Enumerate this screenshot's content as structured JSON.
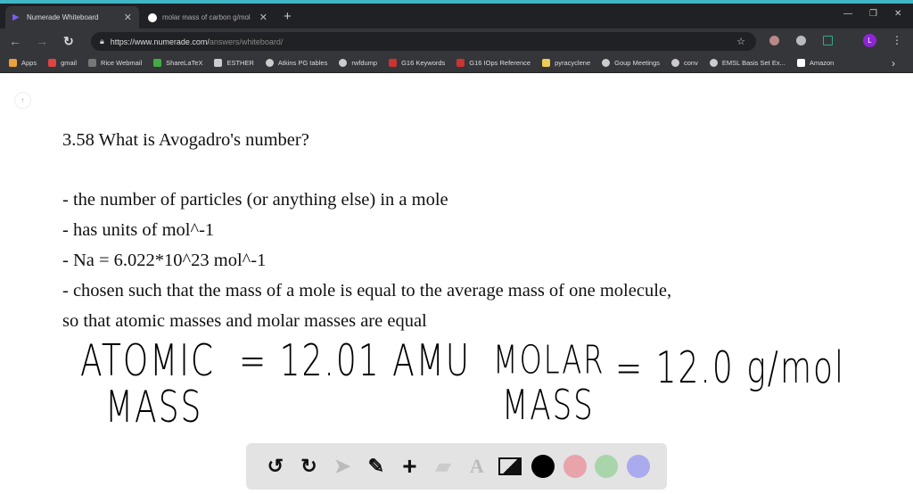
{
  "browser": {
    "tabs": [
      {
        "title": "Numerade Whiteboard",
        "active": true
      },
      {
        "title": "molar mass of carbon g/mol",
        "active": false
      }
    ],
    "url_host": "https://www.numerade.com/",
    "url_path": "answers/whiteboard/",
    "profile_initial": "L",
    "bookmarks": [
      "Apps",
      "gmail",
      "Rice Webmail",
      "ShareLaTeX",
      "ESTHER",
      "Atkins PG tables",
      "rwfdump",
      "G16 Keywords",
      "G16 IOps Reference",
      "pyracyclene",
      "Goup Meetings",
      "conv",
      "EMSL Basis Set Ex...",
      "Amazon"
    ]
  },
  "whiteboard": {
    "page_indicator": "↑",
    "title": "3.58 What is Avogadro's number?",
    "lines": [
      "- the number of particles (or anything else) in a mole",
      "- has units of mol^-1",
      "- Na = 6.022*10^23 mol^-1",
      "- chosen such that the mass of a mole is equal to the average mass of one molecule,",
      "so that atomic masses and molar masses are equal"
    ],
    "handwriting": {
      "atomic": "ATOMIC",
      "atomic_mass": "MASS",
      "atomic_value": "= 12.01 AMU",
      "molar": "MOLAR",
      "molar_mass": "MASS",
      "molar_value": "= 12.0 g/mol"
    }
  },
  "toolbar": {
    "colors": {
      "black": "#000000",
      "red": "#e8a4aa",
      "green": "#a8d5aa",
      "blue": "#aaaaee"
    }
  }
}
